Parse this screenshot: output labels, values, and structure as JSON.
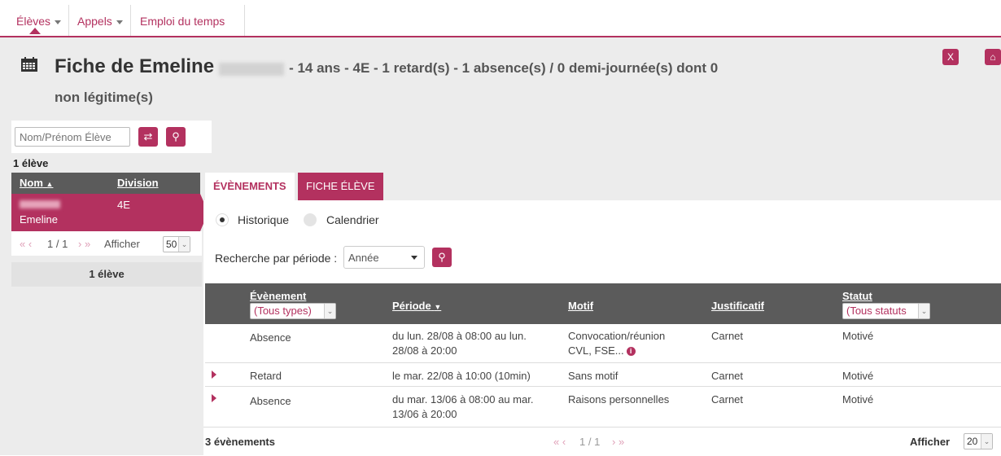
{
  "nav": {
    "items": [
      {
        "label": "Élèves"
      },
      {
        "label": "Appels"
      },
      {
        "label": "Emploi du temps"
      }
    ]
  },
  "header": {
    "title_prefix": "Fiche de Emeline",
    "title_details": "- 14 ans - 4E - 1 retard(s) - 1 absence(s) / 0 demi-journée(s) dont 0",
    "title_line2": "non légitime(s)"
  },
  "left": {
    "search_placeholder": "Nom/Prénom Élève",
    "count_label": "1 élève",
    "columns": {
      "name": "Nom",
      "division": "Division"
    },
    "row": {
      "first_name": "Emeline",
      "division": "4E"
    },
    "pager": {
      "position": "1 / 1",
      "show_label": "Afficher",
      "page_size": "50"
    },
    "footer_count": "1 élève"
  },
  "tabs": {
    "events": "ÉVÈNEMENTS",
    "student": "FICHE ÉLÈVE"
  },
  "view": {
    "history": "Historique",
    "calendar": "Calendrier"
  },
  "filter": {
    "label": "Recherche par période :",
    "period": "Année"
  },
  "table": {
    "columns": {
      "event": "Évènement",
      "event_filter": "(Tous types)",
      "period": "Période",
      "reason": "Motif",
      "proof": "Justificatif",
      "status": "Statut",
      "status_filter": "(Tous statuts"
    },
    "rows": [
      {
        "event": "Absence",
        "period_line1": "du lun. 28/08 à 08:00 au lun.",
        "period_line2": "28/08 à 20:00",
        "reason_line1": "Convocation/réunion",
        "reason_line2": "CVL, FSE...",
        "proof": "Carnet",
        "status": "Motivé"
      },
      {
        "event": "Retard",
        "period_line1": "le mar. 22/08 à 10:00 (10min)",
        "period_line2": "",
        "reason_line1": "Sans motif",
        "reason_line2": "",
        "proof": "Carnet",
        "status": "Motivé"
      },
      {
        "event": "Absence",
        "period_line1": "du mar. 13/06 à 08:00 au mar.",
        "period_line2": "13/06 à 20:00",
        "reason_line1": "Raisons personnelles",
        "reason_line2": "",
        "proof": "Carnet",
        "status": "Motivé"
      }
    ],
    "footer_count": "3 évènements",
    "pager_position": "1 / 1",
    "show_label": "Afficher",
    "page_size": "20"
  }
}
